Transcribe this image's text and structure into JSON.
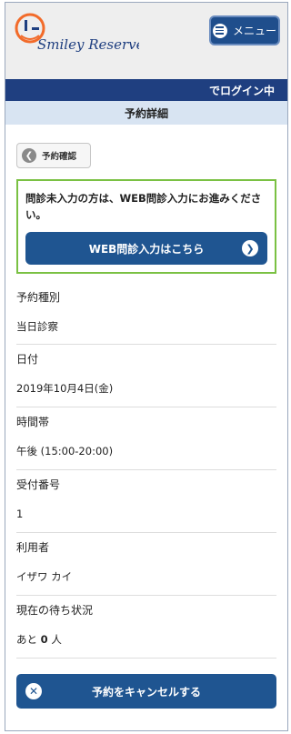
{
  "header": {
    "logo_text": "Smiley Reserve",
    "menu_label": "メニュー"
  },
  "login_status": "でログイン中",
  "page_title": "予約詳細",
  "back_button": {
    "label": "予約確認",
    "icon": "arrow-left-circle-icon"
  },
  "notice": {
    "text": "問診未入力の方は、WEB問診入力にお進みください。",
    "button_label": "WEB問診入力はこちら",
    "button_icon": "chevron-right-icon"
  },
  "details": [
    {
      "label": "予約種別",
      "value": "当日診察"
    },
    {
      "label": "日付",
      "value": "2019年10月4日(金)"
    },
    {
      "label": "時間帯",
      "value": "午後 (15:00-20:00)"
    },
    {
      "label": "受付番号",
      "value": "1"
    },
    {
      "label": "利用者",
      "value": "イザワ カイ"
    }
  ],
  "wait_status": {
    "label": "現在の待ち状況",
    "prefix": "あと",
    "count": "0",
    "suffix": "人"
  },
  "cancel_button": {
    "label": "予約をキャンセルする",
    "icon": "close-icon"
  },
  "colors": {
    "primary": "#1f5591",
    "login_bar": "#1f3f80",
    "title_bar": "#d8e4f2",
    "notice_border": "#7ac143",
    "logo_orange": "#f26b2a"
  }
}
